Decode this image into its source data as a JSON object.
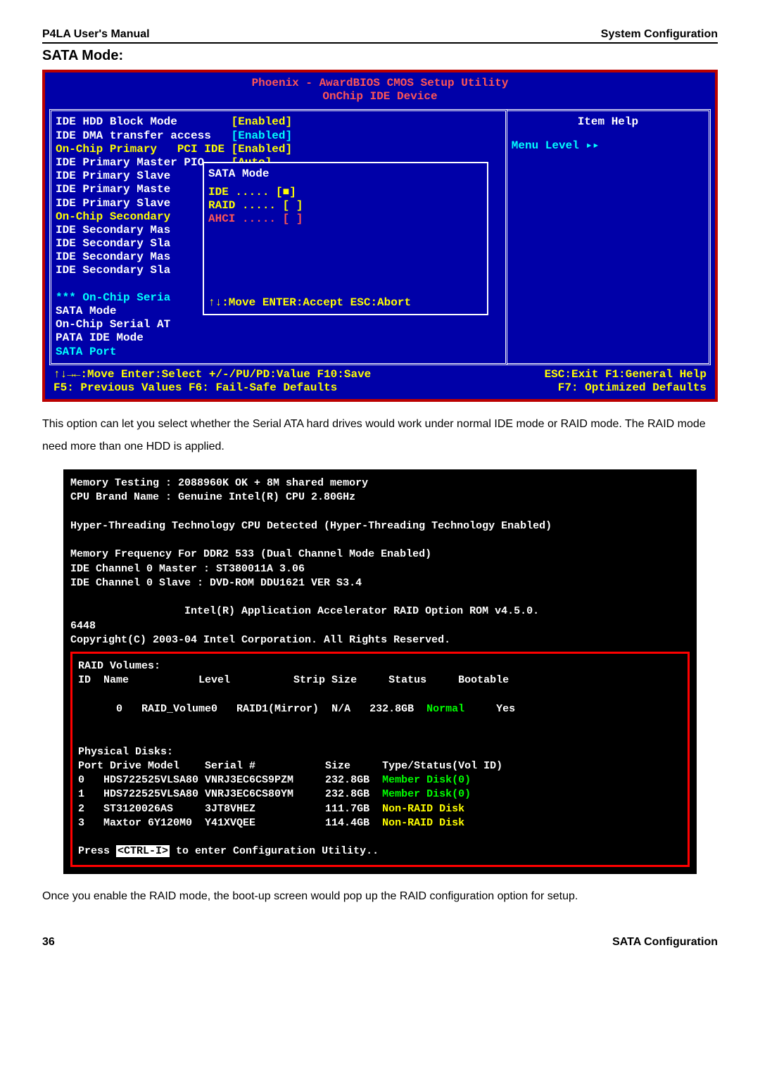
{
  "header": {
    "left": "P4LA User's Manual",
    "right": "System Configuration"
  },
  "section_title": "SATA Mode:",
  "bios": {
    "title1": "Phoenix - AwardBIOS CMOS Setup Utility",
    "title2": "OnChip IDE Device",
    "left_lines": [
      {
        "l": "IDE HDD Block Mode",
        "v": "[Enabled]",
        "lc": "wht",
        "vc": "yel"
      },
      {
        "l": "IDE DMA transfer access",
        "v": "[Enabled]",
        "lc": "wht",
        "vc": "cyn"
      },
      {
        "l": "On-Chip Primary   PCI IDE",
        "v": "[Enabled]",
        "lc": "yel",
        "vc": "yel"
      },
      {
        "l": "IDE Primary Master PIO",
        "v": "[Auto]",
        "lc": "wht",
        "vc": "yel"
      },
      {
        "l": "IDE Primary Slave",
        "v": "",
        "lc": "wht",
        "vc": ""
      },
      {
        "l": "IDE Primary Maste",
        "v": "",
        "lc": "wht",
        "vc": ""
      },
      {
        "l": "IDE Primary Slave",
        "v": "",
        "lc": "wht",
        "vc": ""
      },
      {
        "l": "On-Chip Secondary",
        "v": "",
        "lc": "yel",
        "vc": ""
      },
      {
        "l": "IDE Secondary Mas",
        "v": "",
        "lc": "wht",
        "vc": ""
      },
      {
        "l": "IDE Secondary Sla",
        "v": "",
        "lc": "wht",
        "vc": ""
      },
      {
        "l": "IDE Secondary Mas",
        "v": "",
        "lc": "wht",
        "vc": ""
      },
      {
        "l": "IDE Secondary Sla",
        "v": "",
        "lc": "wht",
        "vc": ""
      },
      {
        "l": "",
        "v": "",
        "lc": "",
        "vc": ""
      },
      {
        "l": "*** On-Chip Seria",
        "v": "",
        "lc": "cyn",
        "vc": ""
      },
      {
        "l": "SATA Mode",
        "v": "",
        "lc": "wht",
        "vc": ""
      },
      {
        "l": "On-Chip Serial AT",
        "v": "",
        "lc": "wht",
        "vc": ""
      },
      {
        "l": "PATA IDE Mode",
        "v": "",
        "lc": "wht",
        "vc": ""
      },
      {
        "l": "SATA Port",
        "v": "",
        "lc": "cyn",
        "vc": ""
      }
    ],
    "popup": {
      "title": "SATA Mode",
      "opts": [
        {
          "t": "IDE  ..... [",
          "m": "■",
          "a": "]"
        },
        {
          "t": "RAID ..... [ ]",
          "m": "",
          "a": ""
        },
        {
          "t": "AHCI ..... [ ]",
          "m": "",
          "a": "",
          "cls": "red"
        }
      ],
      "hint": "↑↓:Move ENTER:Accept ESC:Abort"
    },
    "right": {
      "head": "Item Help",
      "menu": "Menu Level   ▸▸"
    },
    "footer": {
      "l1a": "↑↓→←:Move  Enter:Select  +/-/PU/PD:Value  F10:Save",
      "l1b": "ESC:Exit  F1:General Help",
      "l2a": "F5: Previous Values    F6: Fail-Safe Defaults",
      "l2b": "F7: Optimized Defaults"
    }
  },
  "para1": "This option can let you select whether the Serial ATA hard drives would work under normal IDE mode or RAID mode. The RAID mode need more than one HDD is applied.",
  "boot": {
    "mem": "Memory Testing : 2088960K OK +  8M shared memory",
    "cpu": "CPU Brand Name : Genuine Intel(R) CPU 2.80GHz",
    "ht1": "Hyper-Threading Technology CPU Detected (Hyper-Threading Technology ",
    "ht2": "Enabled",
    "ht3": ")",
    "mf": " Memory Frequency For DDR2 533  (Dual Channel Mode Enabled)",
    "ch0m": "IDE Channel 0 Master : ST380011A 3.06",
    "ch0s": "IDE Channel 0 Slave  : DVD-ROM DDU1621 VER S3.4",
    "app": "                  Intel(R) Application Accelerator RAID Option ROM v4.5.0.",
    "num": "6448",
    "copy": "Copyright(C) 2003-04 Intel Corporation.  All Rights Reserved.",
    "rv_title": "RAID Volumes:",
    "rv_head": "ID  Name           Level          Strip Size     Status     Bootable",
    "rv_row": "0   RAID_Volume0   RAID1(Mirror)  N/A   232.8GB  Normal     Yes",
    "pd_title": "Physical Disks:",
    "pd_head": "Port Drive Model    Serial #           Size     Type/Status(Vol ID)",
    "pd_rows": [
      "0   HDS722525VLSA80 VNRJ3EC6CS9PZM     232.8GB  Member Disk(0)",
      "1   HDS722525VLSA80 VNRJ3EC6CS80YM     232.8GB  Member Disk(0)",
      "2   ST3120026AS     3JT8VHEZ           111.7GB  Non-RAID Disk",
      "3   Maxtor 6Y120M0  Y41XVQEE           114.4GB  Non-RAID Disk"
    ],
    "press1": "Press ",
    "press_key": "<CTRL-I>",
    "press2": " to enter Configuration Utility.."
  },
  "para2": "Once you enable the RAID mode, the boot-up screen would pop up the RAID configuration option for setup.",
  "footer": {
    "page": "36",
    "label": "SATA Configuration"
  }
}
